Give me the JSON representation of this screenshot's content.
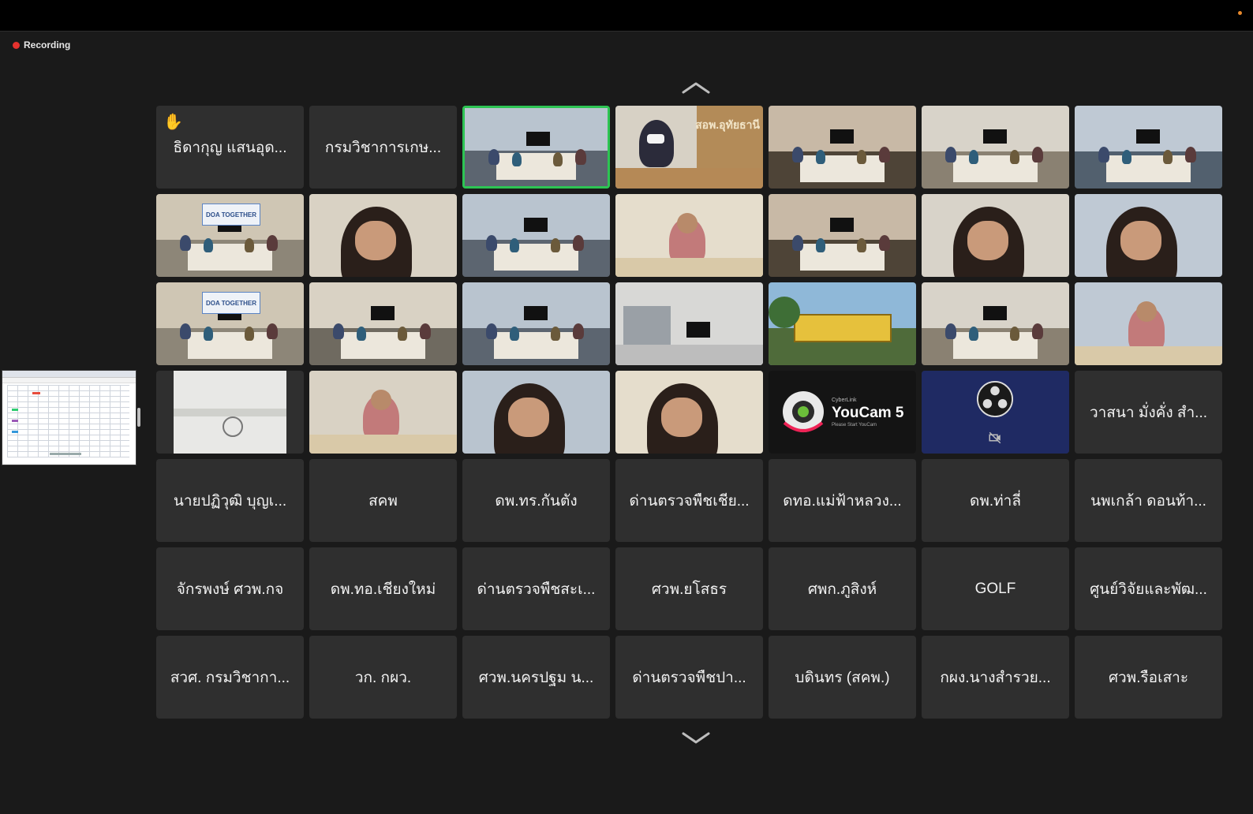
{
  "recording": {
    "label": "Recording"
  },
  "navigation": {
    "up_icon": "chevron-up-icon",
    "down_icon": "chevron-down-icon"
  },
  "youcam": {
    "brand": "CyberLink",
    "title": "YouCam 5",
    "subtitle": "Please Start YouCam"
  },
  "accent": {
    "active_speaker": "#2dc453",
    "recording": "#e5322e",
    "tile_bg": "#2f2f2f"
  },
  "participants": [
    {
      "name": "ธิดากุญ แสนอุด...",
      "raised_hand": true
    },
    {
      "name": "กรมวิชาการเกษ..."
    },
    {
      "video": "meeting-room",
      "active": true
    },
    {
      "video": "office-mask",
      "sign": "สอพ.อุทัยธานี"
    },
    {
      "video": "meeting-room"
    },
    {
      "video": "meeting-room"
    },
    {
      "video": "meeting-room"
    },
    {
      "video": "meeting-room",
      "banner": "DOA TOGETHER"
    },
    {
      "video": "person-closeup"
    },
    {
      "video": "meeting-room"
    },
    {
      "video": "person-desk"
    },
    {
      "video": "meeting-room"
    },
    {
      "video": "person-closeup"
    },
    {
      "video": "person-closeup"
    },
    {
      "video": "meeting-room",
      "banner": "DOA TOGETHER"
    },
    {
      "video": "meeting-room"
    },
    {
      "video": "meeting-room"
    },
    {
      "video": "office"
    },
    {
      "video": "outdoor-sign"
    },
    {
      "video": "meeting-room"
    },
    {
      "video": "person-desk"
    },
    {
      "video": "ceiling"
    },
    {
      "video": "person-desk"
    },
    {
      "video": "person-closeup"
    },
    {
      "video": "person-closeup"
    },
    {
      "video": "youcam"
    },
    {
      "video": "obs",
      "camera_off": true
    },
    {
      "name": "วาสนา มั่งคั่ง สำ..."
    },
    {
      "name": "นายปฏิวุฒิ บุญเ..."
    },
    {
      "name": "สคพ"
    },
    {
      "name": "ดพ.ทร.กันตัง"
    },
    {
      "name": "ด่านตรวจพืชเชีย..."
    },
    {
      "name": "ดทอ.แม่ฟ้าหลวง..."
    },
    {
      "name": "ดพ.ท่าลี่"
    },
    {
      "name": "นพเกล้า ดอนท้า..."
    },
    {
      "name": "จักรพงษ์ ศวพ.กจ"
    },
    {
      "name": "ดพ.ทอ.เชียงใหม่"
    },
    {
      "name": "ด่านตรวจพืชสะเ..."
    },
    {
      "name": "ศวพ.ยโสธร"
    },
    {
      "name": "ศพก.ภูสิงห์"
    },
    {
      "name": "GOLF"
    },
    {
      "name": "ศูนย์วิจัยและพัฒ..."
    },
    {
      "name": "สวศ. กรมวิชากา..."
    },
    {
      "name": "วก. กผว."
    },
    {
      "name": "ศวพ.นครปฐม น..."
    },
    {
      "name": "ด่านตรวจพืชปา..."
    },
    {
      "name": "บดินทร (สคพ.)"
    },
    {
      "name": "กผง.นางสำรวย..."
    },
    {
      "name": "ศวพ.รือเสาะ"
    }
  ]
}
